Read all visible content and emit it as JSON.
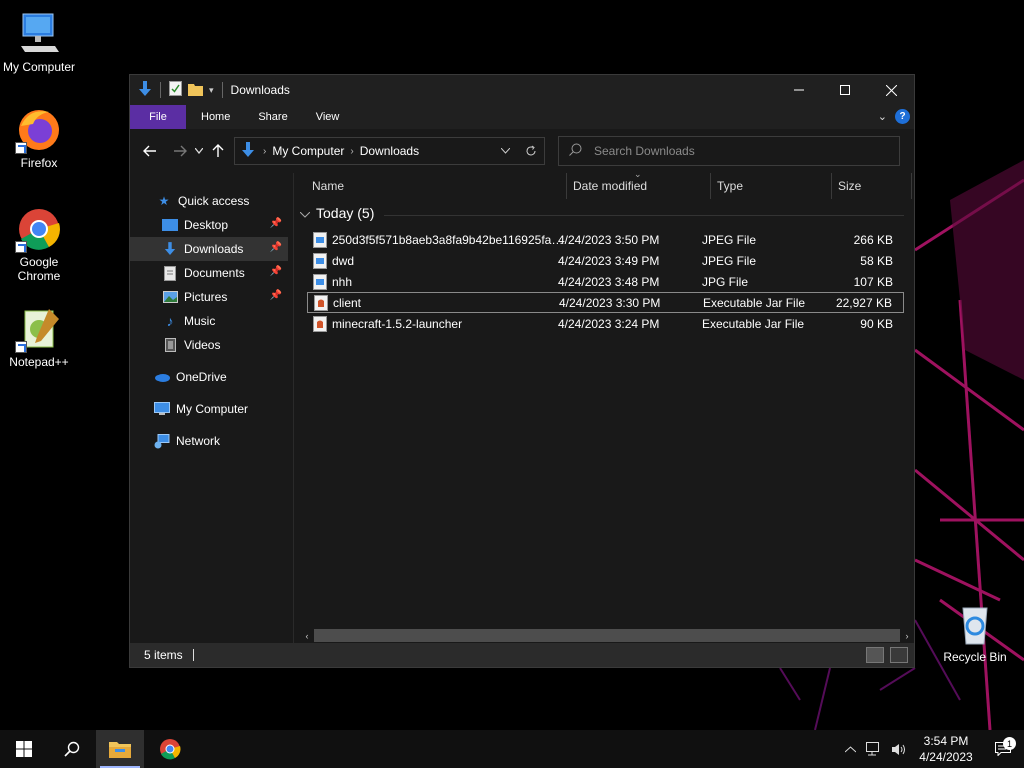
{
  "desktop": {
    "icons": [
      {
        "label": "My Computer"
      },
      {
        "label": "Firefox"
      },
      {
        "label": "Google Chrome"
      },
      {
        "label": "Notepad++"
      },
      {
        "label": "Recycle Bin"
      }
    ]
  },
  "window": {
    "title": "Downloads",
    "ribbon_tabs": [
      "File",
      "Home",
      "Share",
      "View"
    ],
    "address": {
      "crumbs": [
        "My Computer",
        "Downloads"
      ]
    },
    "search": {
      "placeholder": "Search Downloads"
    },
    "nav": {
      "quick_access": "Quick access",
      "items": [
        {
          "label": "Desktop",
          "pinned": true
        },
        {
          "label": "Downloads",
          "pinned": true,
          "selected": true
        },
        {
          "label": "Documents",
          "pinned": true
        },
        {
          "label": "Pictures",
          "pinned": true
        },
        {
          "label": "Music",
          "pinned": false
        },
        {
          "label": "Videos",
          "pinned": false
        }
      ],
      "onedrive": "OneDrive",
      "my_computer": "My Computer",
      "network": "Network"
    },
    "columns": [
      "Name",
      "Date modified",
      "Type",
      "Size"
    ],
    "group": "Today (5)",
    "files": [
      {
        "name": "250d3f5f571b8aeb3a8fa9b42be116925faa...",
        "date": "4/24/2023 3:50 PM",
        "type": "JPEG File",
        "size": "266 KB",
        "icon": "image-file-icon"
      },
      {
        "name": "dwd",
        "date": "4/24/2023 3:49 PM",
        "type": "JPEG File",
        "size": "58 KB",
        "icon": "image-file-icon"
      },
      {
        "name": "nhh",
        "date": "4/24/2023 3:48 PM",
        "type": "JPG File",
        "size": "107 KB",
        "icon": "image-file-icon"
      },
      {
        "name": "client",
        "date": "4/24/2023 3:30 PM",
        "type": "Executable Jar File",
        "size": "22,927 KB",
        "icon": "jar-file-icon"
      },
      {
        "name": "minecraft-1.5.2-launcher",
        "date": "4/24/2023 3:24 PM",
        "type": "Executable Jar File",
        "size": "90 KB",
        "icon": "jar-file-icon"
      }
    ],
    "status": "5 items"
  },
  "taskbar": {
    "time": "3:54 PM",
    "date": "4/24/2023",
    "notification_count": "1"
  },
  "colors": {
    "accent_file_tab": "#5b2ea3",
    "window_bg": "#191919",
    "selection": "#333333",
    "folder_blue": "#3d8ee6"
  }
}
